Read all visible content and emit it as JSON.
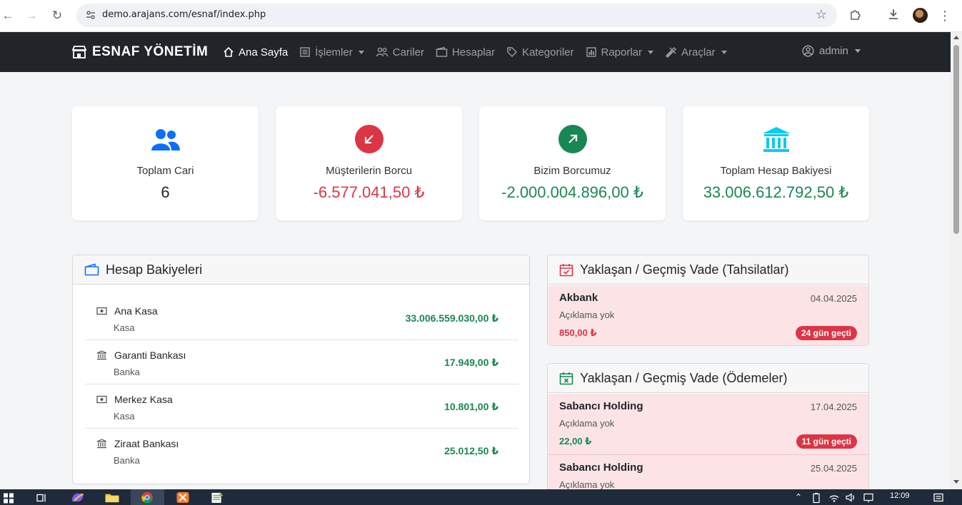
{
  "browser": {
    "url": "demo.arajans.com/esnaf/index.php"
  },
  "navbar": {
    "brand": "ESNAF YÖNETİM",
    "items": [
      {
        "label": "Ana Sayfa",
        "icon": "home-icon"
      },
      {
        "label": "İşlemler",
        "icon": "list-icon"
      },
      {
        "label": "Cariler",
        "icon": "users-icon"
      },
      {
        "label": "Hesaplar",
        "icon": "wallet-icon"
      },
      {
        "label": "Kategoriler",
        "icon": "tag-icon"
      },
      {
        "label": "Raporlar",
        "icon": "chart-icon"
      },
      {
        "label": "Araçlar",
        "icon": "tools-icon"
      }
    ],
    "user": "admin"
  },
  "stats": [
    {
      "label": "Toplam Cari",
      "value": "6",
      "color": "#212529",
      "icon_color": "#0d6efd"
    },
    {
      "label": "Müşterilerin Borcu",
      "value": "-6.577.041,50 ₺",
      "color": "#dc3545",
      "icon_color": "#dc3545"
    },
    {
      "label": "Bizim Borcumuz",
      "value": "-2.000.004.896,00 ₺",
      "color": "#198754",
      "icon_color": "#198754"
    },
    {
      "label": "Toplam Hesap Bakiyesi",
      "value": "33.006.612.792,50 ₺",
      "color": "#198754",
      "icon_color": "#0dcaf0"
    }
  ],
  "accounts_panel": {
    "title": "Hesap Bakiyeleri",
    "rows": [
      {
        "name": "Ana Kasa",
        "type": "Kasa",
        "balance": "33.006.559.030,00 ₺",
        "icon": "cash-icon"
      },
      {
        "name": "Garanti Bankası",
        "type": "Banka",
        "balance": "17.949,00 ₺",
        "icon": "bank-icon"
      },
      {
        "name": "Merkez Kasa",
        "type": "Kasa",
        "balance": "10.801,00 ₺",
        "icon": "cash-icon"
      },
      {
        "name": "Ziraat Bankası",
        "type": "Banka",
        "balance": "25.012,50 ₺",
        "icon": "bank-icon"
      }
    ]
  },
  "collections_panel": {
    "title": "Yaklaşan / Geçmiş Vade (Tahsilatlar)",
    "items": [
      {
        "name": "Akbank",
        "date": "04.04.2025",
        "desc": "Açıklama yok",
        "amount": "850,00 ₺",
        "badge": "24 gün geçti",
        "amount_color": "#dc3545"
      }
    ]
  },
  "payments_panel": {
    "title": "Yaklaşan / Geçmiş Vade (Ödemeler)",
    "items": [
      {
        "name": "Sabancı Holding",
        "date": "17.04.2025",
        "desc": "Açıklama yok",
        "amount": "22,00 ₺",
        "badge": "11 gün geçti",
        "amount_color": "#198754"
      },
      {
        "name": "Sabancı Holding",
        "date": "25.04.2025",
        "desc": "Açıklama yok"
      }
    ]
  },
  "taskbar": {
    "clock": "12:09"
  }
}
